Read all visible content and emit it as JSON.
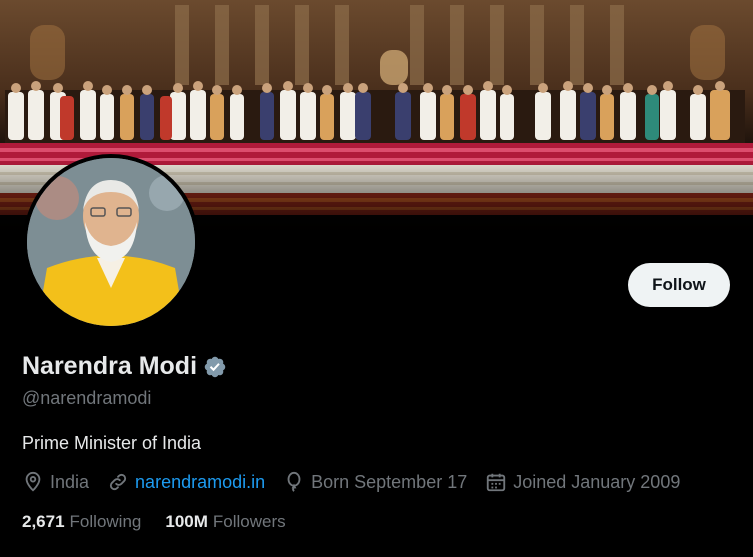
{
  "profile": {
    "name": "Narendra Modi",
    "handle": "@narendramodi",
    "bio": "Prime Minister of India",
    "location": "India",
    "website": "narendramodi.in",
    "birthday": "Born September 17",
    "joined": "Joined January 2009"
  },
  "stats": {
    "following_count": "2,671",
    "following_label": "Following",
    "followers_count": "100M",
    "followers_label": "Followers"
  },
  "actions": {
    "follow_label": "Follow"
  },
  "colors": {
    "background": "#000000",
    "link": "#1d9bf0",
    "muted_text": "#71767b",
    "verified_badge": "#829aab",
    "follow_button_bg": "#eff3f4"
  },
  "icons": {
    "verified": "verified-badge-icon",
    "location": "location-pin-icon",
    "website": "link-icon",
    "birthday": "balloon-icon",
    "joined": "calendar-icon"
  }
}
